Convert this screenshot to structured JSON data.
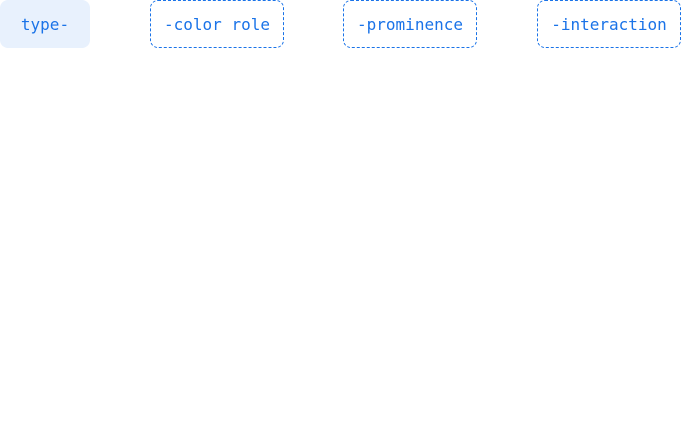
{
  "tokens": {
    "type": "type-",
    "color_role": "-color role",
    "prominence": "-prominence",
    "interaction": "-interaction"
  },
  "colors": {
    "accent": "#1a73e8",
    "type_chip_bg": "#e8f1fd",
    "faded_text": "#f3f4f6"
  },
  "columns": {
    "type": [
      "",
      "",
      "",
      ""
    ],
    "color_role": [
      "",
      "",
      "",
      "",
      "",
      "",
      "",
      ""
    ],
    "prominence": [
      "",
      "",
      "",
      ""
    ],
    "interaction": [
      "",
      "",
      ""
    ]
  }
}
